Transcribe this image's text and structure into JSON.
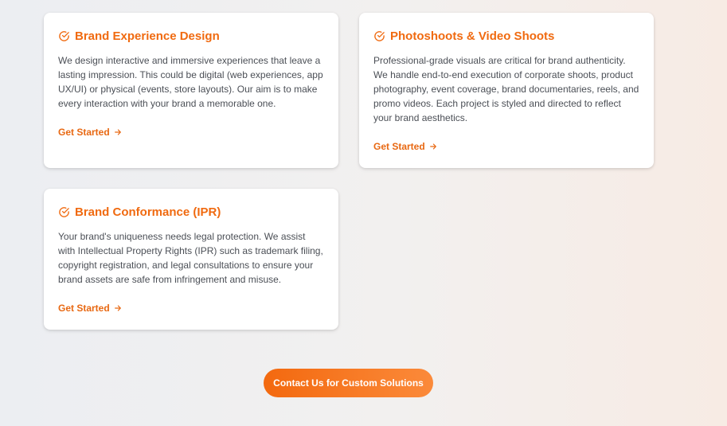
{
  "cards": [
    {
      "icon": "check-circle-icon",
      "title": "Brand Experience Design",
      "description": "We design interactive and immersive experiences that leave a lasting impression. This could be digital (web experiences, app UX/UI) or physical (events, store layouts). Our aim is to make every interaction with your brand a memorable one.",
      "cta": "Get Started"
    },
    {
      "icon": "check-circle-icon",
      "title": "Photoshoots & Video Shoots",
      "description": "Professional-grade visuals are critical for brand authenticity. We handle end-to-end execution of corporate shoots, product photography, event coverage, brand documentaries, reels, and promo videos. Each project is styled and directed to reflect your brand aesthetics.",
      "cta": "Get Started"
    },
    {
      "icon": "check-circle-icon",
      "title": "Brand Conformance (IPR)",
      "description": "Your brand's uniqueness needs legal protection. We assist with Intellectual Property Rights (IPR) such as trademark filing, copyright registration, and legal consultations to ensure your brand assets are safe from infringement and misuse.",
      "cta": "Get Started"
    }
  ],
  "contact_button": "Contact Us for Custom Solutions",
  "colors": {
    "accent": "#f06a10",
    "text": "#4b4f56",
    "card_bg": "#ffffff"
  }
}
